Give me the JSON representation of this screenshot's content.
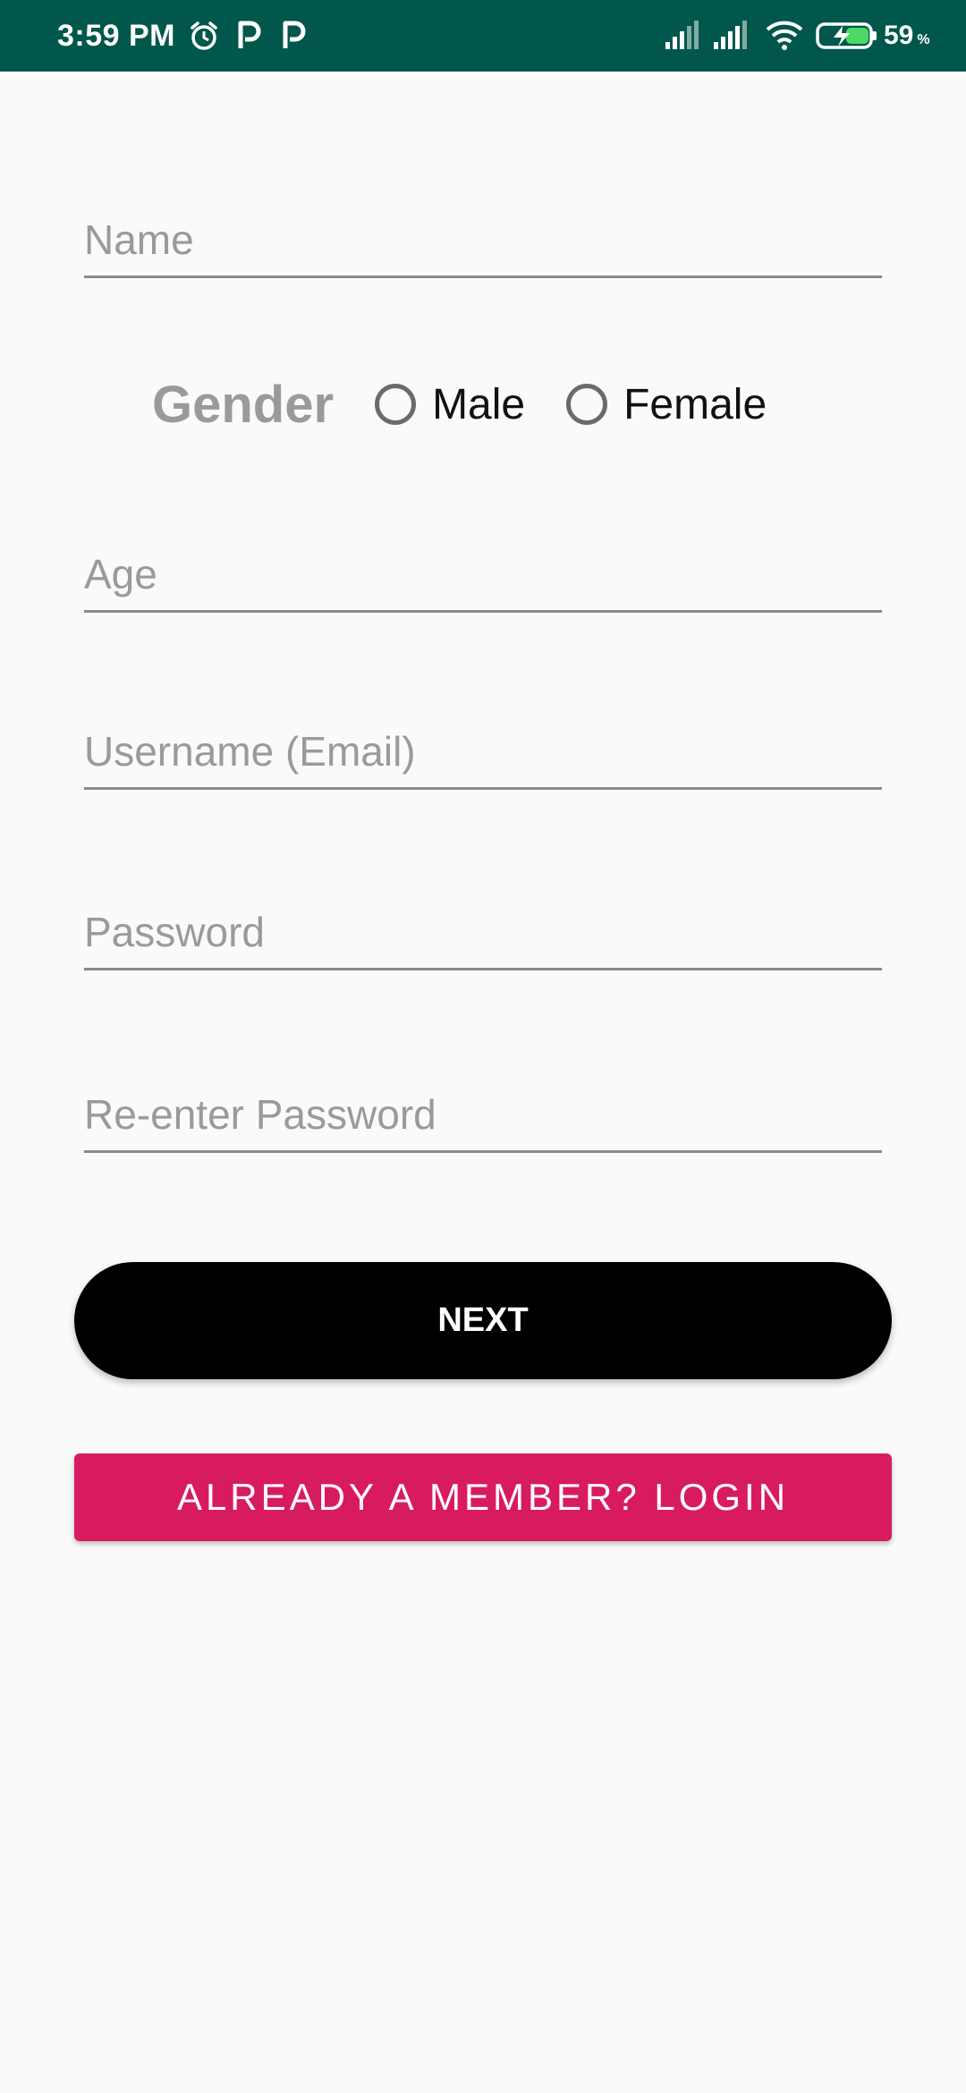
{
  "status_bar": {
    "time": "3:59 PM",
    "battery_percent": "59",
    "battery_unit": "%",
    "background_color": "#01574b",
    "icons": [
      "alarm-icon",
      "parking-icon",
      "parking-icon",
      "cellular-signal-icon",
      "cellular-signal-icon",
      "wifi-icon",
      "battery-charging-icon"
    ]
  },
  "form": {
    "name_placeholder": "Name",
    "gender_label": "Gender",
    "gender_options": [
      "Male",
      "Female"
    ],
    "age_placeholder": "Age",
    "username_placeholder": "Username (Email)",
    "password_placeholder": "Password",
    "reenter_password_placeholder": "Re-enter Password"
  },
  "buttons": {
    "next_label": "NEXT",
    "login_label": "ALREADY A MEMBER? LOGIN",
    "login_color": "#d81b60",
    "next_color": "#000000"
  }
}
